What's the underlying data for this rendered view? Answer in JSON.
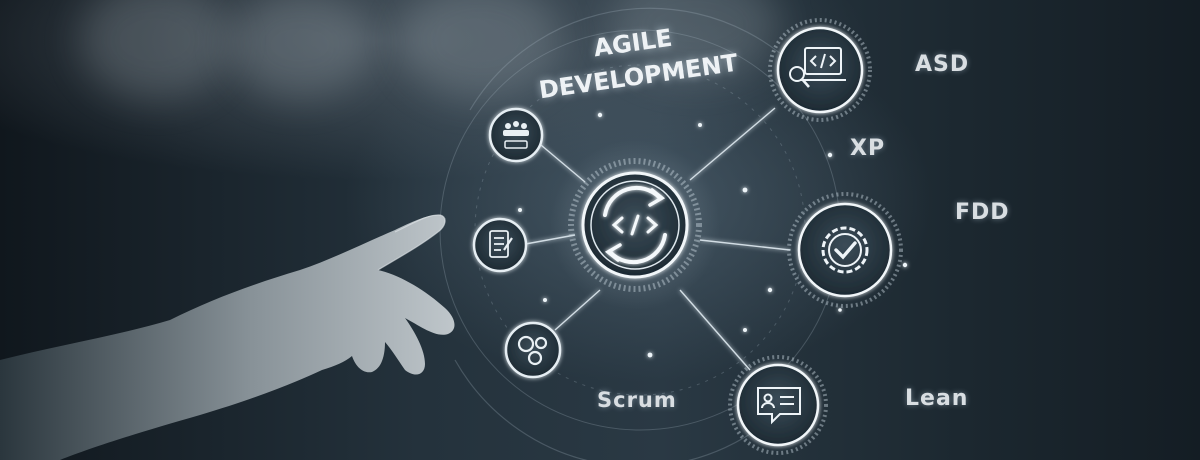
{
  "hub": {
    "title_line1": "AGILE",
    "title_line2": "DEVELOPMENT",
    "center_icon": "code-cycle-icon"
  },
  "methods": {
    "asd": "ASD",
    "xp": "XP",
    "fdd": "FDD",
    "scrum": "Scrum",
    "lean": "Lean"
  },
  "icons": {
    "team": "team-icon",
    "document": "document-icon",
    "gears": "gears-icon",
    "developer": "developer-laptop-icon",
    "quality": "quality-badge-icon",
    "profile": "profile-message-icon"
  },
  "colors": {
    "background": "#1b2730",
    "glow": "#e8f1f7",
    "line": "#c9d6de"
  }
}
